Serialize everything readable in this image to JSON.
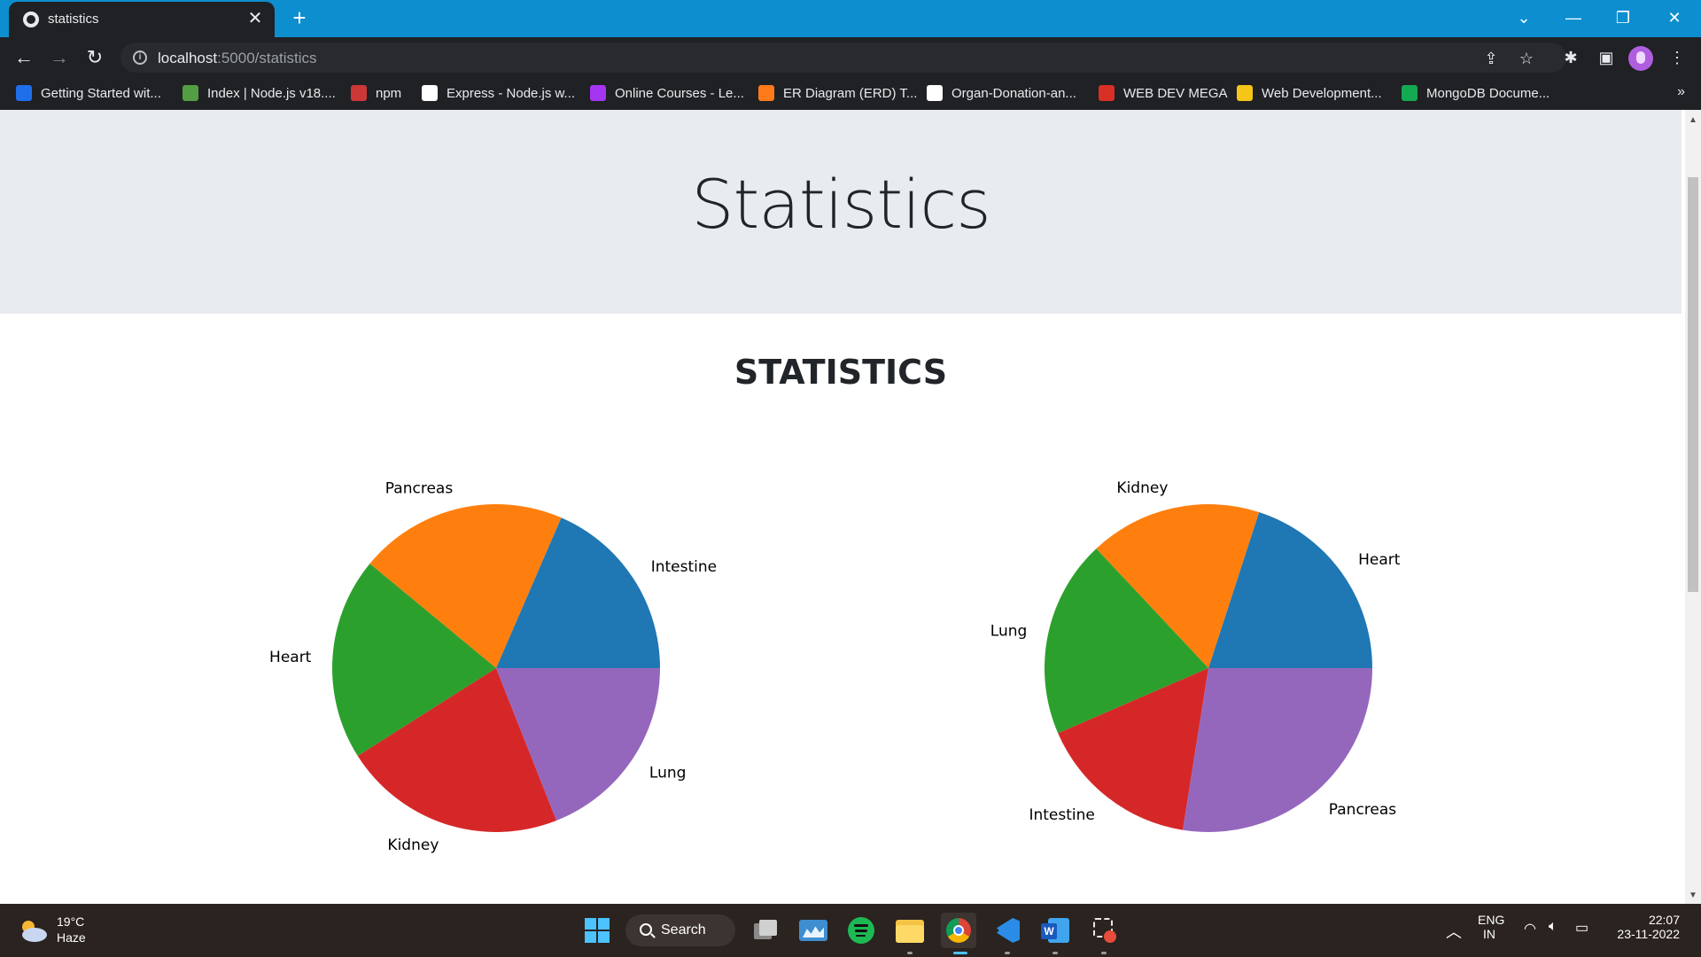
{
  "browser": {
    "tab_title": "statistics",
    "tab_close": "✕",
    "new_tab": "+",
    "url_host": "localhost",
    "url_path": ":5000/statistics",
    "bookmarks": [
      {
        "label": "Getting Started wit...",
        "color": "#1f6feb"
      },
      {
        "label": "Index | Node.js v18....",
        "color": "#539e43"
      },
      {
        "label": "npm",
        "color": "#cb3837"
      },
      {
        "label": "Express - Node.js w...",
        "color": "#ffffff"
      },
      {
        "label": "Online Courses - Le...",
        "color": "#a435f0"
      },
      {
        "label": "ER Diagram (ERD) T...",
        "color": "#ff7a1a"
      },
      {
        "label": "Organ-Donation-an...",
        "color": "#ffffff"
      },
      {
        "label": "WEB DEV MEGA",
        "color": "#d93025"
      },
      {
        "label": "Web Development...",
        "color": "#f5c518"
      },
      {
        "label": "MongoDB Docume...",
        "color": "#13aa52"
      }
    ],
    "bookmarks_more": "»"
  },
  "page": {
    "jumbotron_title": "Statistics",
    "heading": "STATISTICS"
  },
  "colors": {
    "blue": "#1f77b4",
    "orange": "#ff7f0e",
    "green": "#2ca02c",
    "red": "#d62728",
    "purple": "#9467bd"
  },
  "chart_data": [
    {
      "type": "pie",
      "title": "",
      "start_angle_deg": 0,
      "slices": [
        {
          "label": "Intestine",
          "value": 18.5,
          "color": "#1f77b4"
        },
        {
          "label": "Pancreas",
          "value": 20.5,
          "color": "#ff7f0e"
        },
        {
          "label": "Heart",
          "value": 20.0,
          "color": "#2ca02c"
        },
        {
          "label": "Kidney",
          "value": 22.0,
          "color": "#d62728"
        },
        {
          "label": "Lung",
          "value": 19.0,
          "color": "#9467bd"
        }
      ]
    },
    {
      "type": "pie",
      "title": "",
      "start_angle_deg": 0,
      "slices": [
        {
          "label": "Heart",
          "value": 20.0,
          "color": "#1f77b4"
        },
        {
          "label": "Kidney",
          "value": 17.0,
          "color": "#ff7f0e"
        },
        {
          "label": "Lung",
          "value": 19.5,
          "color": "#2ca02c"
        },
        {
          "label": "Intestine",
          "value": 16.0,
          "color": "#d62728"
        },
        {
          "label": "Pancreas",
          "value": 27.5,
          "color": "#9467bd"
        }
      ]
    }
  ],
  "taskbar": {
    "temperature": "19°C",
    "condition": "Haze",
    "search_label": "Search",
    "language": "ENG",
    "region": "IN",
    "time": "22:07",
    "date": "23-11-2022"
  }
}
